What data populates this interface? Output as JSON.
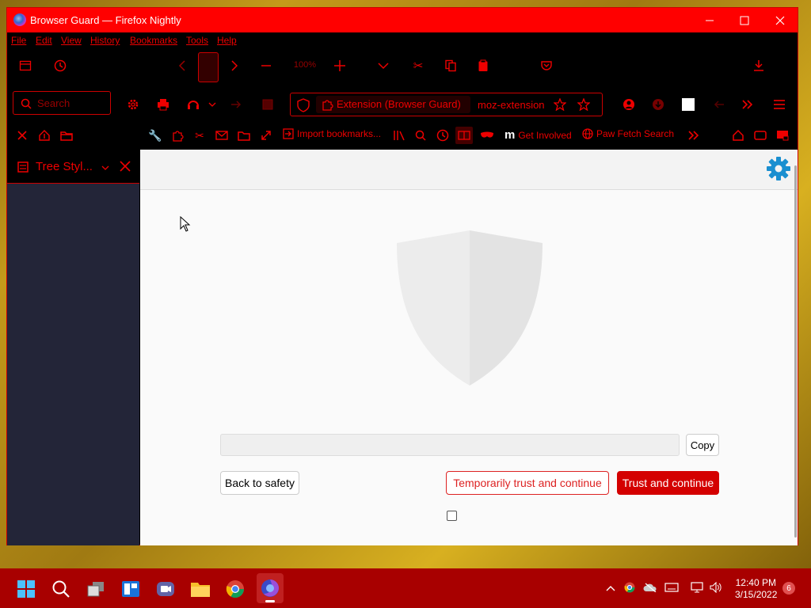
{
  "window": {
    "title": "Browser Guard — Firefox Nightly"
  },
  "menu": [
    "File",
    "Edit",
    "View",
    "History",
    "Bookmarks",
    "Tools",
    "Help"
  ],
  "toolbar": {
    "zoom": "100%",
    "search_placeholder": "Search"
  },
  "urlbar": {
    "identity": "Extension (Browser Guard)",
    "url": "moz-extension"
  },
  "bookmarks": {
    "import": "Import bookmarks...",
    "get_involved": "Get Involved",
    "paw_fetch": "Paw Fetch Search"
  },
  "sidebar": {
    "title": "Tree Styl..."
  },
  "page": {
    "copy_label": "Copy",
    "back_label": "Back to safety",
    "temp_trust_label": "Temporarily trust and continue",
    "trust_label": "Trust and continue"
  },
  "taskbar": {
    "time": "12:40 PM",
    "date": "3/15/2022",
    "notif_count": "6"
  },
  "colors": {
    "accent": "#e00000",
    "titlebar": "#ff0000",
    "taskbar": "#a80000",
    "settings_gear": "#1a8fd0"
  }
}
